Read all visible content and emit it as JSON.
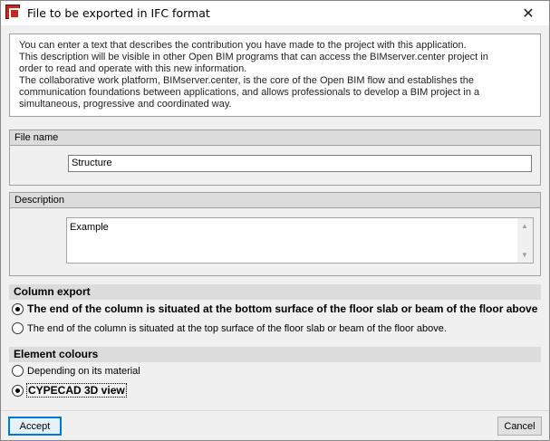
{
  "window": {
    "title": "File to be exported in IFC format",
    "close_glyph": "✕",
    "icon": "cype-app-icon"
  },
  "info": {
    "text": "You can enter a text that describes the contribution you have made to the project with this application.\nThis description will be visible in other Open BIM programs that can access the BIMserver.center project in\norder to read and operate with this new information.\nThe collaborative work platform, BIMserver.center, is the core of the Open BIM flow and establishes the\ncommunication foundations between applications, and allows professionals to develop a BIM project in a\nsimultaneous, progressive and coordinated way."
  },
  "file_name": {
    "label": "File name",
    "value": "Structure"
  },
  "description": {
    "label": "Description",
    "value": "Example"
  },
  "column_export": {
    "title": "Column export",
    "options": [
      {
        "label": "The end of the column is situated at the bottom surface of the floor slab or beam of the floor above",
        "checked": true
      },
      {
        "label": "The end of the column is situated at the top surface of the floor slab or beam of the floor above.",
        "checked": false
      }
    ]
  },
  "element_colours": {
    "title": "Element colours",
    "options": [
      {
        "label": "Depending on its material",
        "checked": false
      },
      {
        "label": "CYPECAD 3D view",
        "checked": true
      }
    ]
  },
  "buttons": {
    "accept": "Accept",
    "cancel": "Cancel"
  }
}
